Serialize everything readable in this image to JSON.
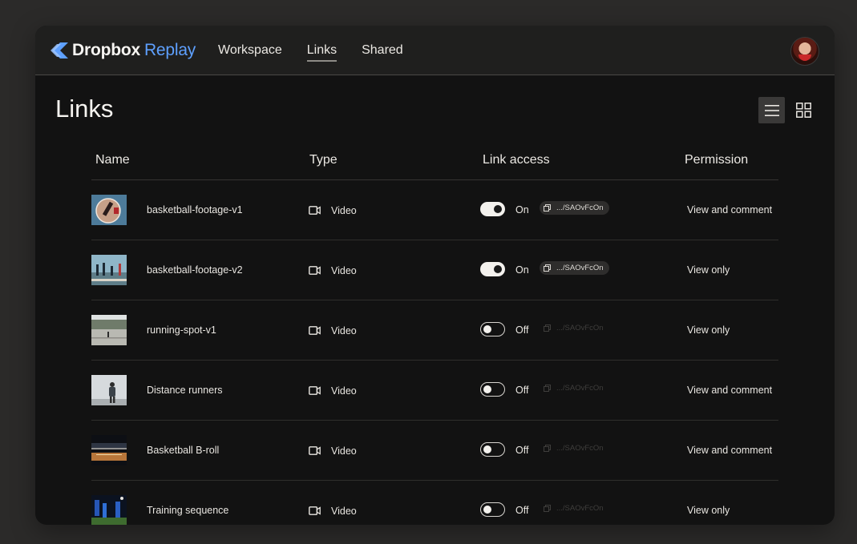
{
  "app": {
    "brand": "Dropbox",
    "brand_accent": "Replay",
    "accent_color": "#5ea0ff"
  },
  "nav": {
    "items": [
      {
        "label": "Workspace",
        "active": false
      },
      {
        "label": "Links",
        "active": true
      },
      {
        "label": "Shared",
        "active": false
      }
    ]
  },
  "page": {
    "title": "Links"
  },
  "view_toggle": {
    "list_icon": "list-view-icon",
    "grid_icon": "grid-view-icon",
    "active": "list"
  },
  "table": {
    "headers": {
      "name": "Name",
      "type": "Type",
      "link_access": "Link access",
      "permission": "Permission"
    },
    "rows": [
      {
        "name": "basketball-footage-v1",
        "type": "Video",
        "access": "On",
        "link": ".../SAOvFcOn",
        "permission": "View and comment"
      },
      {
        "name": "basketball-footage-v2",
        "type": "Video",
        "access": "On",
        "link": ".../SAOvFcOn",
        "permission": "View only"
      },
      {
        "name": "running-spot-v1",
        "type": "Video",
        "access": "Off",
        "link": ".../SAOvFcOn",
        "permission": "View only"
      },
      {
        "name": "Distance runners",
        "type": "Video",
        "access": "Off",
        "link": ".../SAOvFcOn",
        "permission": "View and comment"
      },
      {
        "name": "Basketball B-roll",
        "type": "Video",
        "access": "Off",
        "link": ".../SAOvFcOn",
        "permission": "View and comment"
      },
      {
        "name": "Training sequence",
        "type": "Video",
        "access": "Off",
        "link": ".../SAOvFcOn",
        "permission": "View only"
      }
    ]
  }
}
